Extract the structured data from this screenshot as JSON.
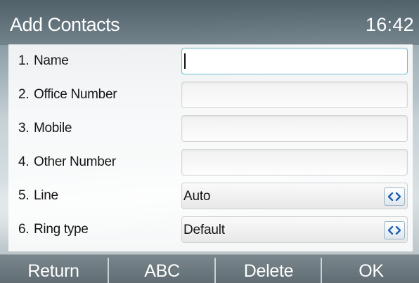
{
  "header": {
    "title": "Add Contacts",
    "clock": "16:42"
  },
  "form": {
    "rows": [
      {
        "number": "1.",
        "label": "Name",
        "type": "text",
        "value": "",
        "focused": true
      },
      {
        "number": "2.",
        "label": "Office Number",
        "type": "text",
        "value": ""
      },
      {
        "number": "3.",
        "label": "Mobile",
        "type": "text",
        "value": ""
      },
      {
        "number": "4.",
        "label": "Other Number",
        "type": "text",
        "value": ""
      },
      {
        "number": "5.",
        "label": "Line",
        "type": "select",
        "value": "Auto"
      },
      {
        "number": "6.",
        "label": "Ring type",
        "type": "select",
        "value": "Default"
      }
    ]
  },
  "softkeys": {
    "return_label": "Return",
    "abc_label": "ABC",
    "delete_label": "Delete",
    "ok_label": "OK"
  },
  "icons": {
    "select_toggle": "left-right-arrows-icon"
  },
  "colors": {
    "focus_border": "#6ec0d2",
    "arrow_blue": "#1c5fb0",
    "header_text": "#ffffff"
  }
}
